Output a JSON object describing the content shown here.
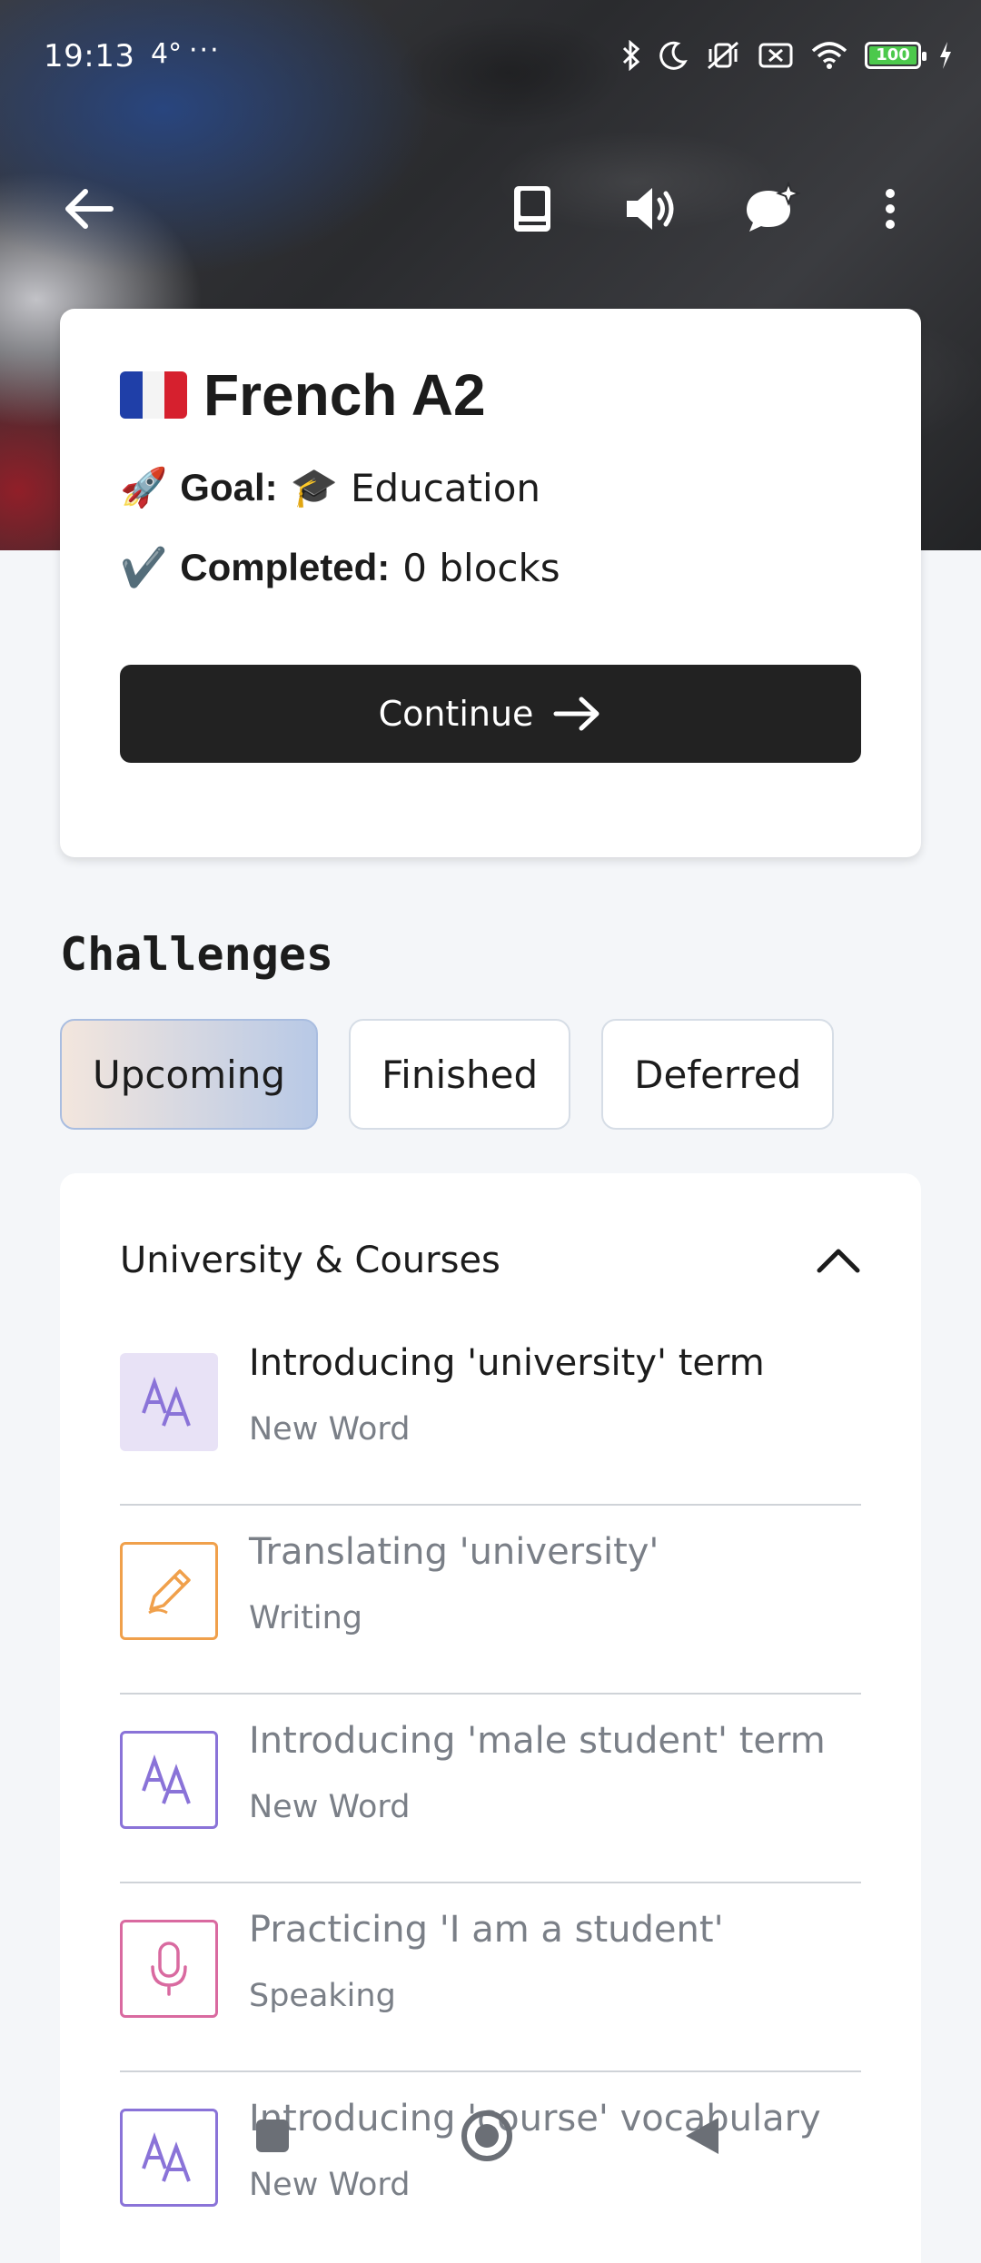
{
  "status_bar": {
    "time": "19:13",
    "temperature": "4°",
    "more": "···",
    "battery": "100",
    "battery_level": 1.0,
    "icons": [
      "bluetooth-icon",
      "moon-icon",
      "vibrate-off-icon",
      "sim-off-icon",
      "wifi-icon",
      "battery-icon",
      "charging-icon"
    ]
  },
  "toolbar": {
    "icons": [
      "back-arrow-icon",
      "book-icon",
      "speaker-icon",
      "ai-chat-icon",
      "more-vertical-icon"
    ]
  },
  "course": {
    "title": "French A2",
    "goal_emoji": "🚀",
    "goal_label": "Goal:",
    "goal_value_emoji": "🎓",
    "goal_value": "Education",
    "completed_emoji": "✔️",
    "completed_label": "Completed:",
    "completed_value": "0 blocks",
    "continue_label": "Continue"
  },
  "challenges": {
    "title": "Challenges",
    "tabs": [
      {
        "label": "Upcoming",
        "active": true
      },
      {
        "label": "Finished",
        "active": false
      },
      {
        "label": "Deferred",
        "active": false
      }
    ],
    "group": {
      "title": "University & Courses",
      "tasks": [
        {
          "title": "Introducing 'university' term",
          "type": "New Word",
          "icon": "font-size-icon",
          "color": "#8a73d8",
          "active": true
        },
        {
          "title": "Translating 'university'",
          "type": "Writing",
          "icon": "pencil-icon",
          "color": "#f0a04b",
          "active": false
        },
        {
          "title": "Introducing 'male student' term",
          "type": "New Word",
          "icon": "font-size-icon",
          "color": "#8a73d8",
          "active": false
        },
        {
          "title": "Practicing 'I am a student'",
          "type": "Speaking",
          "icon": "microphone-icon",
          "color": "#d96aa0",
          "active": false
        },
        {
          "title": "Introducing 'course' vocabulary",
          "type": "New Word",
          "icon": "font-size-icon",
          "color": "#8a73d8",
          "active": false
        }
      ]
    }
  },
  "nav": {
    "icons": [
      "recents-icon",
      "home-icon",
      "back-icon"
    ]
  }
}
